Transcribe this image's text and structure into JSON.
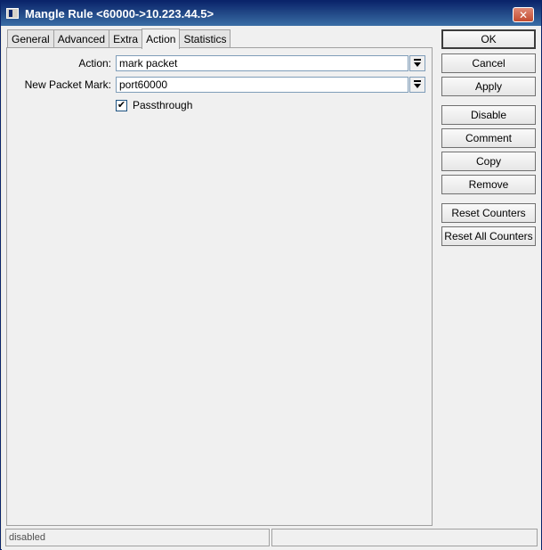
{
  "window": {
    "title": "Mangle Rule <60000->10.223.44.5>",
    "close_glyph": "✕"
  },
  "tabs": [
    {
      "label": "General",
      "active": false
    },
    {
      "label": "Advanced",
      "active": false
    },
    {
      "label": "Extra",
      "active": false
    },
    {
      "label": "Action",
      "active": true
    },
    {
      "label": "Statistics",
      "active": false
    }
  ],
  "form": {
    "action": {
      "label": "Action:",
      "value": "mark packet"
    },
    "new_packet_mark": {
      "label": "New Packet Mark:",
      "value": "port60000"
    },
    "passthrough": {
      "label": "Passthrough",
      "checked": true,
      "glyph": "✔"
    }
  },
  "buttons": {
    "ok": "OK",
    "cancel": "Cancel",
    "apply": "Apply",
    "disable": "Disable",
    "comment": "Comment",
    "copy": "Copy",
    "remove": "Remove",
    "reset_counters": "Reset Counters",
    "reset_all_counters": "Reset All Counters"
  },
  "status": {
    "left": "disabled",
    "right": ""
  },
  "icons": {
    "window": "window-icon",
    "close": "close-icon",
    "dropdown": "dropdown-arrow-icon",
    "check": "checkmark-icon"
  }
}
